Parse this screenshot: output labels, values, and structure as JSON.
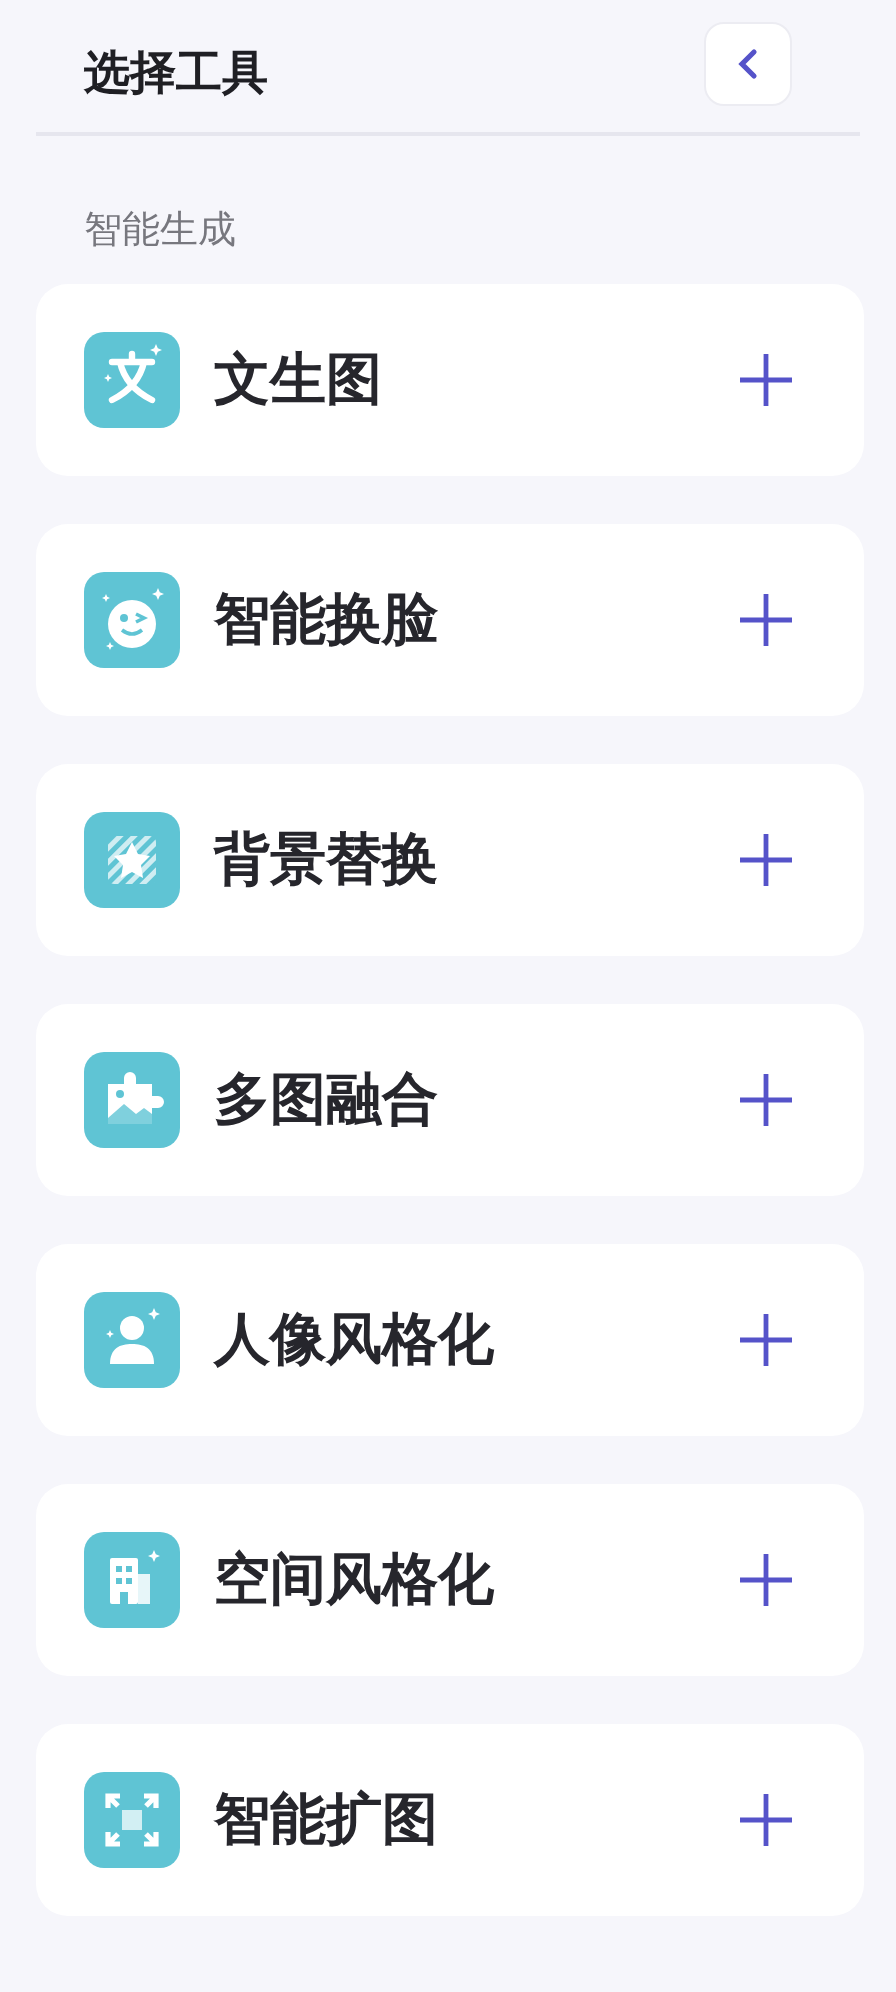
{
  "header": {
    "title": "选择工具"
  },
  "section": {
    "label": "智能生成"
  },
  "tools": [
    {
      "name": "文生图"
    },
    {
      "name": "智能换脸"
    },
    {
      "name": "背景替换"
    },
    {
      "name": "多图融合"
    },
    {
      "name": "人像风格化"
    },
    {
      "name": "空间风格化"
    },
    {
      "name": "智能扩图"
    }
  ]
}
